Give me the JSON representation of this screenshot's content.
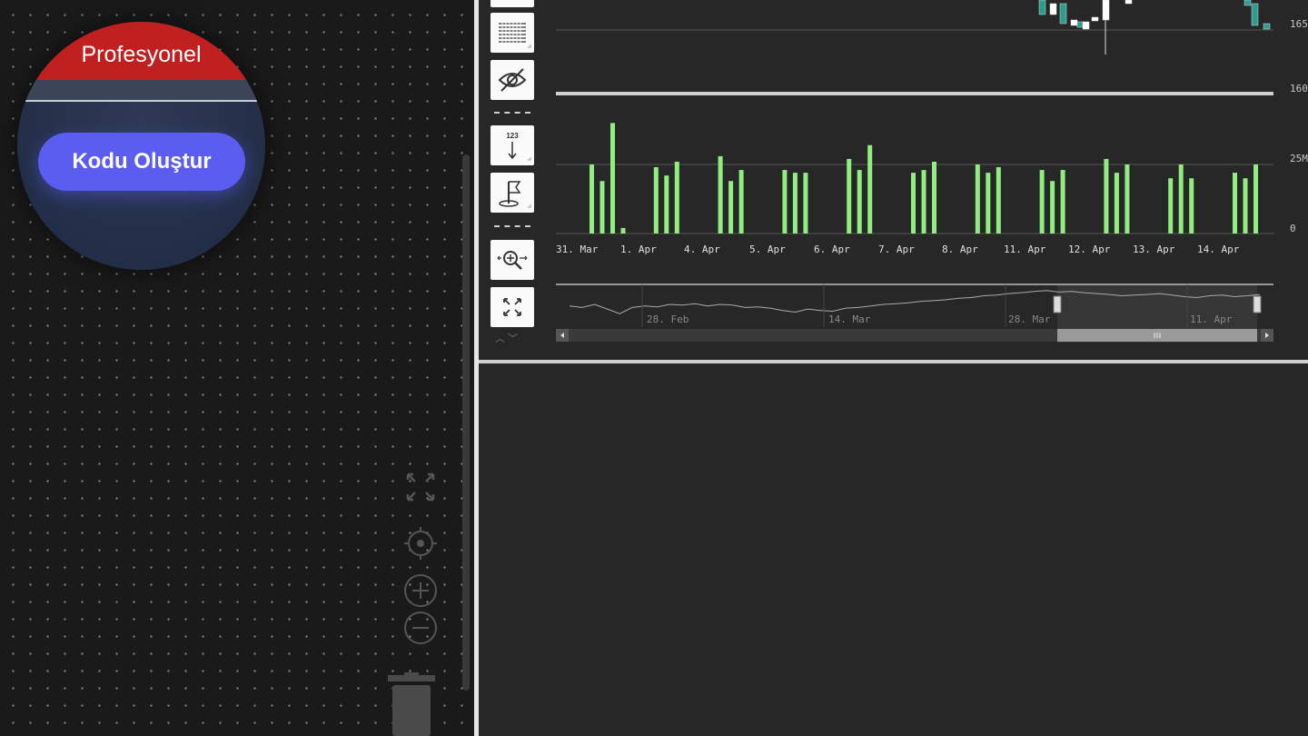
{
  "editor": {
    "lens": {
      "header_text": "Profesyonel",
      "button_label": "Kodu Oluştur"
    },
    "controls": [
      "fit-view-icon",
      "locate-icon",
      "zoom-in-icon",
      "zoom-out-icon",
      "trash-icon"
    ]
  },
  "toolbar": {
    "tools": [
      "grid-icon",
      "hide-eye-icon",
      "values-123-icon",
      "flag-icon",
      "zoom-search-icon",
      "fullscreen-icon"
    ],
    "values_text": "123"
  },
  "chart_data": {
    "type": "bar",
    "price_axis": {
      "labels": [
        "165",
        "160"
      ]
    },
    "volume_axis": {
      "labels": [
        "25M",
        "0"
      ]
    },
    "categories": [
      "31. Mar",
      "1. Apr",
      "4. Apr",
      "5. Apr",
      "6. Apr",
      "7. Apr",
      "8. Apr",
      "11. Apr",
      "12. Apr",
      "13. Apr",
      "14. Apr"
    ],
    "volume_bars": [
      [
        25,
        19,
        40,
        2
      ],
      [
        24,
        21,
        26
      ],
      [
        28,
        19,
        23
      ],
      [
        23,
        22,
        22
      ],
      [
        27,
        23,
        32
      ],
      [
        22,
        23,
        26
      ],
      [
        25,
        22,
        24
      ],
      [
        23,
        19,
        23
      ],
      [
        27,
        22,
        25
      ],
      [
        20,
        25,
        20
      ],
      [
        22,
        20,
        25
      ]
    ],
    "navigator": {
      "labels": [
        "28. Feb",
        "14. Mar",
        "28. Mar",
        "11. Apr"
      ],
      "line": [
        0.55,
        0.6,
        0.5,
        0.65,
        0.8,
        0.6,
        0.55,
        0.58,
        0.5,
        0.52,
        0.48,
        0.55,
        0.5,
        0.52,
        0.6,
        0.58,
        0.62,
        0.7,
        0.75,
        0.65,
        0.7,
        0.72,
        0.62,
        0.6,
        0.55,
        0.5,
        0.48,
        0.45,
        0.4,
        0.38,
        0.35,
        0.3,
        0.28,
        0.22,
        0.2,
        0.15,
        0.12,
        0.08,
        0.05,
        0.1,
        0.08,
        0.12,
        0.15,
        0.18,
        0.22,
        0.2,
        0.18,
        0.15,
        0.2,
        0.25,
        0.28,
        0.22,
        0.2,
        0.25,
        0.22,
        0.18
      ]
    },
    "colors": {
      "volume": "#90ee7e",
      "candle_up": "#ffffff",
      "candle_down": "#2a9d8f",
      "grid": "#555555"
    }
  }
}
